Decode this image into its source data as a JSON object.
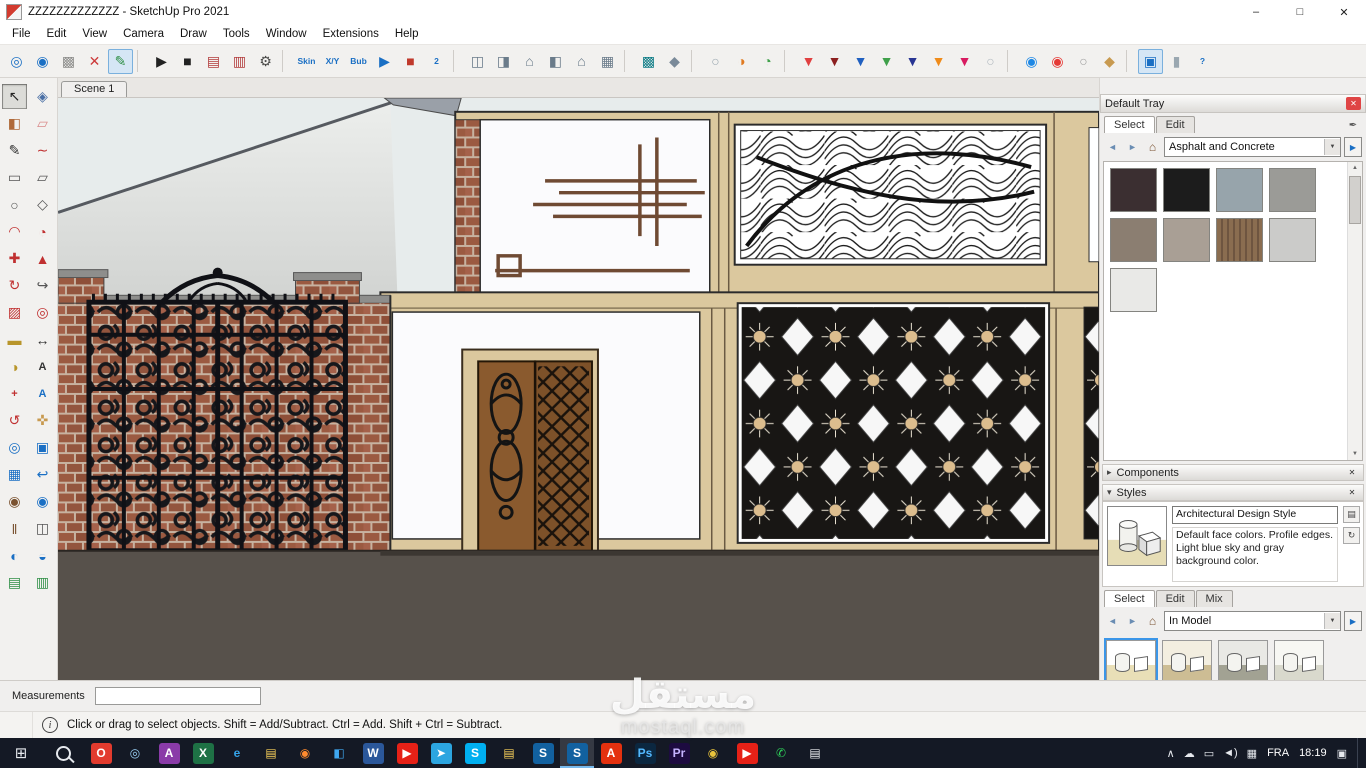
{
  "window": {
    "title": "ZZZZZZZZZZZZZ - SketchUp Pro 2021",
    "minimize": "–",
    "maximize": "□",
    "close": "✕"
  },
  "icons": {
    "back": "◄",
    "forward": "►",
    "home": "⌂",
    "dropdown": "▼",
    "eyedropper": "✒",
    "pane": "▶",
    "comp_arrow": "▸",
    "style_arrow": "▾",
    "close": "✕",
    "scroll_up": "▲",
    "scroll_down": "▼",
    "info": "i",
    "start": "⊞",
    "new_style": "▤",
    "refresh": "↻"
  },
  "menu": {
    "items": [
      "File",
      "Edit",
      "View",
      "Camera",
      "Draw",
      "Tools",
      "Window",
      "Extensions",
      "Help"
    ]
  },
  "toolbar": {
    "icons": [
      {
        "n": "zoom-extents-icon",
        "g": "◎",
        "c": "#1a6fc4"
      },
      {
        "n": "zoom-window-icon",
        "g": "◉",
        "c": "#1a6fc4"
      },
      {
        "n": "standard-views-icon",
        "g": "▩",
        "c": "#8e8e8c"
      },
      {
        "n": "axes-icon",
        "g": "✕",
        "c": "#cc3b3b"
      },
      {
        "n": "edit-mode-icon",
        "g": "✎",
        "c": "#2f8f46",
        "k": "active"
      },
      {
        "n": "toolbar-separator",
        "g": "",
        "k": "sep",
        "ia": "false"
      },
      {
        "n": "play-animation-icon",
        "g": "▶",
        "c": "#222222"
      },
      {
        "n": "stop-animation-icon",
        "g": "■",
        "c": "#222222"
      },
      {
        "n": "export-scene-icon",
        "g": "▤",
        "c": "#b23b3b"
      },
      {
        "n": "record-scene-icon",
        "g": "▥",
        "c": "#b23b3b"
      },
      {
        "n": "settings-gear-icon",
        "g": "⚙",
        "c": "#4a4a48"
      },
      {
        "n": "toolbar-separator",
        "g": "",
        "k": "sep",
        "ia": "false"
      },
      {
        "n": "skin-tool-icon",
        "g": "Skin",
        "c": "#1a6fc4",
        "k": "txt"
      },
      {
        "n": "xy-tool-icon",
        "g": "X/Y",
        "c": "#1a6fc4",
        "k": "txt"
      },
      {
        "n": "bub-tool-icon",
        "g": "Bub",
        "c": "#1a6fc4",
        "k": "txt"
      },
      {
        "n": "run-script-icon",
        "g": "▶",
        "c": "#1a6fc4"
      },
      {
        "n": "stop-script-icon",
        "g": "■",
        "c": "#c0392b"
      },
      {
        "n": "script-2-icon",
        "g": "2",
        "c": "#1a6fc4",
        "k": "txt"
      },
      {
        "n": "toolbar-separator",
        "g": "",
        "k": "sep",
        "ia": "false"
      },
      {
        "n": "outer-shell-icon",
        "g": "◫",
        "c": "#6a7b8a"
      },
      {
        "n": "intersect-icon",
        "g": "◨",
        "c": "#6a7b8a"
      },
      {
        "n": "union-icon",
        "g": "⌂",
        "c": "#6a7b8a"
      },
      {
        "n": "subtract-icon",
        "g": "◧",
        "c": "#6a7b8a"
      },
      {
        "n": "trim-icon",
        "g": "⌂",
        "c": "#6a7b8a"
      },
      {
        "n": "split-icon",
        "g": "▦",
        "c": "#6a7b8a"
      },
      {
        "n": "toolbar-separator",
        "g": "",
        "k": "sep",
        "ia": "false"
      },
      {
        "n": "texture-tool-icon",
        "g": "▩",
        "c": "#0e7c86"
      },
      {
        "n": "tag-tool-icon",
        "g": "◆",
        "c": "#7a8a99"
      },
      {
        "n": "toolbar-separator",
        "g": "",
        "k": "sep",
        "ia": "false"
      },
      {
        "n": "shadows-off-icon",
        "g": "○",
        "c": "#9aa7b0"
      },
      {
        "n": "shadows-orange-icon",
        "g": "◑",
        "c": "#e07a20"
      },
      {
        "n": "shadows-green-icon",
        "g": "◔",
        "c": "#3fa04a"
      },
      {
        "n": "toolbar-separator",
        "g": "",
        "k": "sep",
        "ia": "false"
      },
      {
        "n": "drop-red-icon",
        "g": "▼",
        "c": "#e04040"
      },
      {
        "n": "drop-maroon-icon",
        "g": "▼",
        "c": "#8c1f1f"
      },
      {
        "n": "drop-blue-icon",
        "g": "▼",
        "c": "#2060c0"
      },
      {
        "n": "drop-green-icon",
        "g": "▼",
        "c": "#3fa04a"
      },
      {
        "n": "drop-navy-icon",
        "g": "▼",
        "c": "#283593"
      },
      {
        "n": "drop-orange-icon",
        "g": "▼",
        "c": "#ef8b1a"
      },
      {
        "n": "drop-pink-icon",
        "g": "▼",
        "c": "#d81b60"
      },
      {
        "n": "sphere-tool-icon",
        "g": "○",
        "c": "#b0b8bf"
      },
      {
        "n": "toolbar-separator",
        "g": "",
        "k": "sep",
        "ia": "false"
      },
      {
        "n": "eye-blue-icon",
        "g": "◉",
        "c": "#1e88e5"
      },
      {
        "n": "eye-red-icon",
        "g": "◉",
        "c": "#e53935"
      },
      {
        "n": "circle-gray-icon",
        "g": "○",
        "c": "#9e9e9e"
      },
      {
        "n": "pour-tool-icon",
        "g": "◆",
        "c": "#c89a50"
      },
      {
        "n": "toolbar-separator",
        "g": "",
        "k": "sep",
        "ia": "false"
      },
      {
        "n": "active-tool-icon",
        "g": "▣",
        "c": "#1a6fc4",
        "k": "active"
      },
      {
        "n": "column-tool-icon",
        "g": "▮",
        "c": "#9aa7b0"
      },
      {
        "n": "help-icon",
        "g": "?",
        "c": "#1a6fc4",
        "k": "txt"
      }
    ]
  },
  "left_toolbar": {
    "icons": [
      {
        "n": "select-tool-icon",
        "g": "↖",
        "c": "#222222",
        "k": "active"
      },
      {
        "n": "make-component-icon",
        "g": "◈",
        "c": "#4a6fa5"
      },
      {
        "n": "paint-bucket-icon",
        "g": "◧",
        "c": "#b06a3a"
      },
      {
        "n": "eraser-icon",
        "g": "▱",
        "c": "#d98a8a"
      },
      {
        "n": "line-tool-icon",
        "g": "✎",
        "c": "#333333"
      },
      {
        "n": "freehand-tool-icon",
        "g": "∼",
        "c": "#c03030"
      },
      {
        "n": "rectangle-tool-icon",
        "g": "▭",
        "c": "#555555"
      },
      {
        "n": "rotated-rectangle-tool-icon",
        "g": "▱",
        "c": "#555555"
      },
      {
        "n": "circle-tool-icon",
        "g": "○",
        "c": "#555555"
      },
      {
        "n": "polygon-tool-icon",
        "g": "◇",
        "c": "#555555"
      },
      {
        "n": "arc-tool-icon",
        "g": "◠",
        "c": "#c03030"
      },
      {
        "n": "pie-tool-icon",
        "g": "◔",
        "c": "#c03030"
      },
      {
        "n": "move-tool-icon",
        "g": "✚",
        "c": "#c03030"
      },
      {
        "n": "push-pull-tool-icon",
        "g": "▲",
        "c": "#c03030"
      },
      {
        "n": "rotate-tool-icon",
        "g": "↻",
        "c": "#c03030"
      },
      {
        "n": "follow-me-tool-icon",
        "g": "↪",
        "c": "#555555"
      },
      {
        "n": "scale-tool-icon",
        "g": "▨",
        "c": "#c03030"
      },
      {
        "n": "offset-tool-icon",
        "g": "◎",
        "c": "#c03030"
      },
      {
        "n": "tape-measure-tool-icon",
        "g": "▬",
        "c": "#b8952a"
      },
      {
        "n": "dimension-tool-icon",
        "g": "↔",
        "c": "#333333"
      },
      {
        "n": "protractor-tool-icon",
        "g": "◑",
        "c": "#b8952a"
      },
      {
        "n": "text-tool-icon",
        "g": "A",
        "c": "#333333",
        "k": "txt"
      },
      {
        "n": "axes-tool-icon",
        "g": "+",
        "c": "#c03030",
        "k": "txt"
      },
      {
        "n": "3d-text-tool-icon",
        "g": "A",
        "c": "#1a6fc4",
        "k": "txt"
      },
      {
        "n": "orbit-tool-icon",
        "g": "↺",
        "c": "#c03030"
      },
      {
        "n": "pan-tool-icon",
        "g": "✜",
        "c": "#c89a50"
      },
      {
        "n": "zoom-tool-icon",
        "g": "◎",
        "c": "#1a6fc4"
      },
      {
        "n": "zoom-window-tool-icon",
        "g": "▣",
        "c": "#1a6fc4"
      },
      {
        "n": "zoom-extents-tool-icon",
        "g": "▦",
        "c": "#1a6fc4"
      },
      {
        "n": "previous-view-tool-icon",
        "g": "↩",
        "c": "#1a6fc4"
      },
      {
        "n": "position-camera-tool-icon",
        "g": "◉",
        "c": "#7a5230"
      },
      {
        "n": "look-around-tool-icon",
        "g": "◉",
        "c": "#1a6fc4"
      },
      {
        "n": "walk-tool-icon",
        "g": "‖",
        "c": "#7a5230"
      },
      {
        "n": "section-plane-tool-icon",
        "g": "◫",
        "c": "#555555"
      },
      {
        "n": "sandbox-from-contours-icon",
        "g": "◐",
        "c": "#1a6fc4"
      },
      {
        "n": "sandbox-from-scratch-icon",
        "g": "◒",
        "c": "#1a6fc4"
      },
      {
        "n": "soap-skin-icon",
        "g": "▤",
        "c": "#2f8f46"
      },
      {
        "n": "soap-bubble-icon",
        "g": "▥",
        "c": "#2f8f46"
      }
    ]
  },
  "scene": {
    "tab": "Scene 1"
  },
  "tray": {
    "title": "Default Tray",
    "materials": {
      "tabs": [
        "Select",
        "Edit"
      ],
      "dropdown": "Asphalt and Concrete",
      "swatches": [
        {
          "n": "material-asphalt-dark",
          "bg": "#3b2f31"
        },
        {
          "n": "material-asphalt-black",
          "bg": "#1c1c1c"
        },
        {
          "n": "material-concrete-blue-gray",
          "bg": "#97a4ab"
        },
        {
          "n": "material-concrete-speckled",
          "bg": "#9b9b97"
        },
        {
          "n": "material-concrete-brown-gray",
          "bg": "#8b7e71"
        },
        {
          "n": "material-concrete-warm-gray",
          "bg": "#a99f95"
        },
        {
          "n": "material-wood-boards",
          "bg": "repeating-linear-gradient(90deg,#8a6d50 0 4px,#6e5540 4px 6px)"
        },
        {
          "n": "material-concrete-light",
          "bg": "#cbcbc9"
        },
        {
          "n": "material-concrete-white",
          "bg": "#e9e9e7"
        }
      ]
    },
    "components": {
      "label": "Components"
    },
    "styles": {
      "label": "Styles",
      "name_field": "Architectural Design Style",
      "description": "Default face colors. Profile edges. Light blue sky and gray background color.",
      "tabs": [
        "Select",
        "Edit",
        "Mix"
      ],
      "dropdown": "In Model",
      "thumbs": [
        {
          "n": "style-architectural-design",
          "bg": "linear-gradient(180deg,#ffffff 55%,#e9dfb7 55%)",
          "cls": "sel"
        },
        {
          "n": "style-tan",
          "bg": "linear-gradient(180deg,#f3eee0 55%,#cdbd94 55%)"
        },
        {
          "n": "style-gray",
          "bg": "linear-gradient(180deg,#e9e9e5 55%,#a2a293 55%)"
        },
        {
          "n": "style-pale",
          "bg": "linear-gradient(180deg,#f7f7f3 55%,#d9d9cd 55%)"
        }
      ]
    }
  },
  "measurements": {
    "label": "Measurements"
  },
  "status": {
    "text": "Click or drag to select objects. Shift = Add/Subtract. Ctrl = Add. Shift + Ctrl = Subtract."
  },
  "taskbar": {
    "apps": [
      {
        "n": "taskbar-opera-icon",
        "g": "O",
        "fg": "#ffffff",
        "bg": "#e23b2e"
      },
      {
        "n": "taskbar-cortana-icon",
        "g": "◎",
        "fg": "#9ad0f5"
      },
      {
        "n": "taskbar-access-icon",
        "g": "A",
        "fg": "#ffffff",
        "bg": "#8a3ba8"
      },
      {
        "n": "taskbar-excel-icon",
        "g": "X",
        "fg": "#ffffff",
        "bg": "#1e7145"
      },
      {
        "n": "taskbar-edge-icon",
        "g": "e",
        "fg": "#35a3e8"
      },
      {
        "n": "taskbar-file-explorer-icon",
        "g": "▤",
        "fg": "#f7cf5a"
      },
      {
        "n": "taskbar-firefox-icon",
        "g": "◉",
        "fg": "#ff8b2e"
      },
      {
        "n": "taskbar-vscode-icon",
        "g": "◧",
        "fg": "#3fa7f0"
      },
      {
        "n": "taskbar-word-icon",
        "g": "W",
        "fg": "#ffffff",
        "bg": "#2b579a"
      },
      {
        "n": "taskbar-youtube-icon",
        "g": "▶",
        "fg": "#ffffff",
        "bg": "#e62117"
      },
      {
        "n": "taskbar-telegram-icon",
        "g": "➤",
        "fg": "#ffffff",
        "bg": "#2ca5e0"
      },
      {
        "n": "taskbar-skype-icon",
        "g": "S",
        "fg": "#ffffff",
        "bg": "#00aff0"
      },
      {
        "n": "taskbar-folder-icon",
        "g": "▤",
        "fg": "#f7cf5a"
      },
      {
        "n": "taskbar-sketchup-icon",
        "g": "S",
        "fg": "#ffffff",
        "bg": "#1261a0"
      },
      {
        "n": "taskbar-sketchup-active-icon",
        "g": "S",
        "fg": "#ffffff",
        "bg": "#1261a0",
        "cls": "active"
      },
      {
        "n": "taskbar-acrobat-icon",
        "g": "A",
        "fg": "#ffffff",
        "bg": "#e4310f"
      },
      {
        "n": "taskbar-photoshop-icon",
        "g": "Ps",
        "fg": "#53b9ff",
        "bg": "#0b2740"
      },
      {
        "n": "taskbar-premiere-icon",
        "g": "Pr",
        "fg": "#c5b3ff",
        "bg": "#1d0b40"
      },
      {
        "n": "taskbar-chrome-icon",
        "g": "◉",
        "fg": "#e8c33c"
      },
      {
        "n": "taskbar-youtube2-icon",
        "g": "▶",
        "fg": "#ffffff",
        "bg": "#e62117"
      },
      {
        "n": "taskbar-whatsapp-icon",
        "g": "✆",
        "fg": "#2ece59"
      },
      {
        "n": "taskbar-notepad-icon",
        "g": "▤",
        "fg": "#e8eaec"
      }
    ],
    "tray_icons": [
      {
        "n": "hidden-icons-chevron",
        "g": "∧"
      },
      {
        "n": "onedrive-icon",
        "g": "☁"
      },
      {
        "n": "display-icon",
        "g": "▭"
      },
      {
        "n": "volume-icon",
        "g": "◄)"
      },
      {
        "n": "touch-keyboard-icon",
        "g": "▦"
      }
    ],
    "lang": "FRA",
    "time": "18:19",
    "action_center": "▣"
  },
  "watermark": {
    "title": "مستقل",
    "domain": "mostaql.com"
  }
}
